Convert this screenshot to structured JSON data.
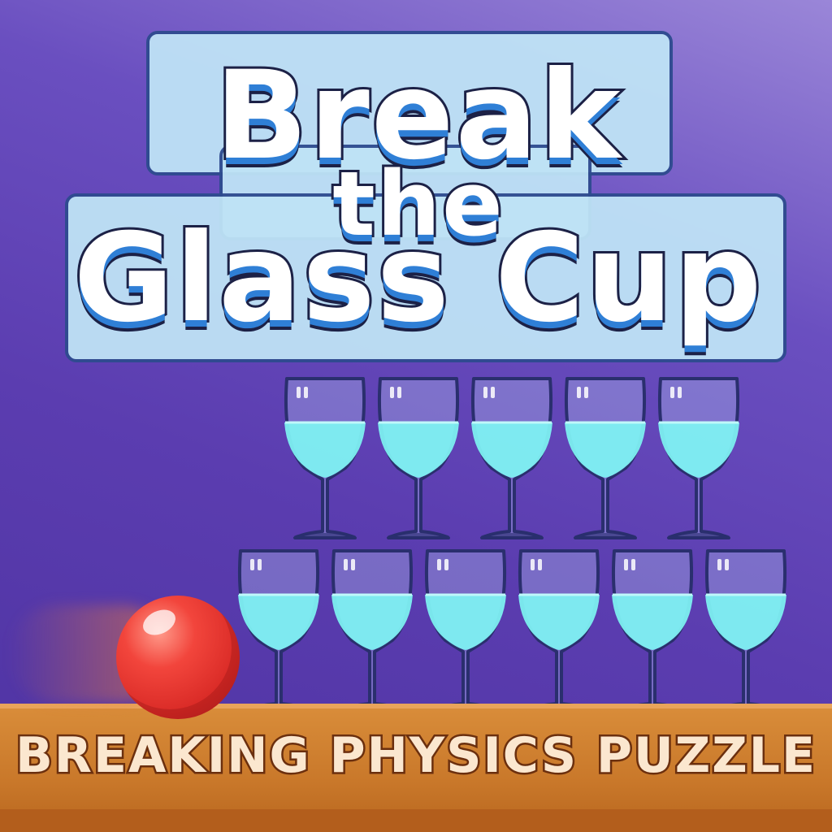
{
  "game": {
    "title_line1": "Break",
    "title_line2": "the",
    "title_line3": "Glass Cup",
    "subtitle": "BREAKING PHYSICS PUZZLE"
  },
  "colors": {
    "background": "#5b3db0",
    "glass_outline": "#2a2f6e",
    "water": "#7ef0f2",
    "ball": "#e0302b",
    "floor": "#c9782a",
    "subtitle_text": "#fbe7cf"
  },
  "glasses": {
    "top_row_count": 5,
    "bottom_row_count": 6
  }
}
